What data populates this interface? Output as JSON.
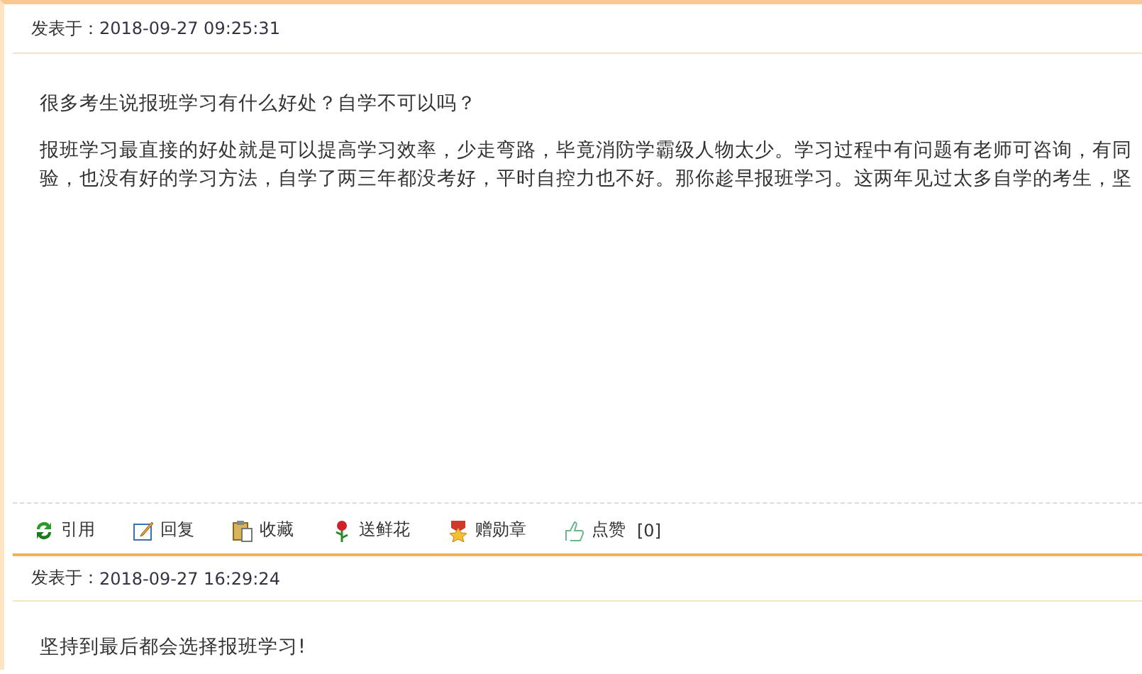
{
  "posts": [
    {
      "label": "发表于：",
      "time": "2018-09-27 09:25:31",
      "question": "很多考生说报班学习有什么好处？自学不可以吗？",
      "lines": [
        "报班学习最直接的好处就是可以提高学习效率，少走弯路，毕竟消防学霸级人物太少。学习过程中有问题有老师可咨询，有同",
        "验，也没有好的学习方法，自学了两三年都没考好，平时自控力也不好。那你趁早报班学习。这两年见过太多自学的考生，坚"
      ],
      "actions": [
        {
          "kind": "quote",
          "label": "引用"
        },
        {
          "kind": "reply",
          "label": "回复"
        },
        {
          "kind": "favorite",
          "label": "收藏"
        },
        {
          "kind": "flower",
          "label": "送鲜花"
        },
        {
          "kind": "medal",
          "label": "赠勋章"
        },
        {
          "kind": "like",
          "label": "点赞",
          "count": "[0]"
        }
      ]
    },
    {
      "label": "发表于：",
      "time": "2018-09-27 16:29:24",
      "question": "坚持到最后都会选择报班学习!"
    }
  ]
}
